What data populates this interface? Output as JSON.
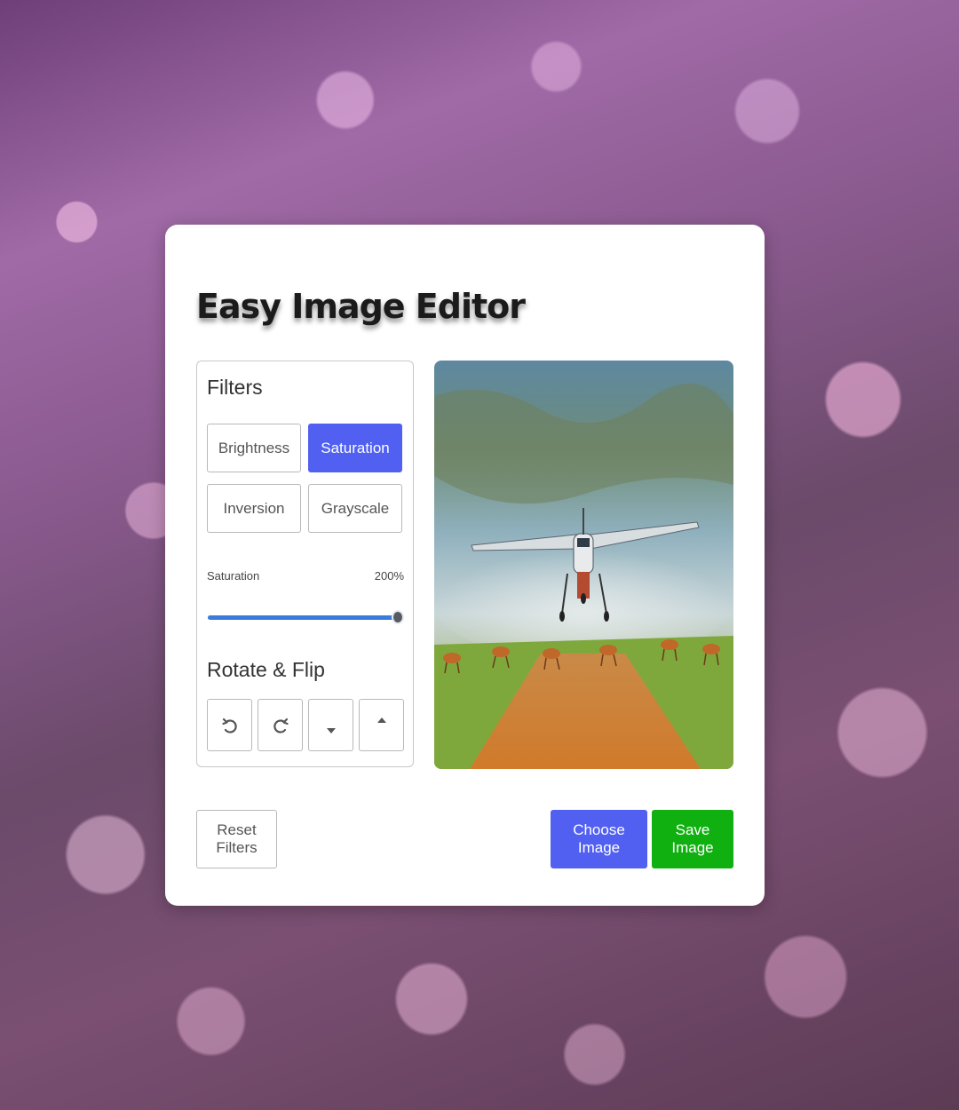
{
  "app": {
    "title": "Easy Image Editor"
  },
  "filters": {
    "title": "Filters",
    "buttons": [
      {
        "label": "Brightness",
        "active": false
      },
      {
        "label": "Saturation",
        "active": true
      },
      {
        "label": "Inversion",
        "active": false
      },
      {
        "label": "Grayscale",
        "active": false
      }
    ],
    "active_color": "#5160f0"
  },
  "slider": {
    "name": "Saturation",
    "value_text": "200%",
    "value": 200,
    "max": 200,
    "fill_color": "#3a7bdc"
  },
  "rotate_flip": {
    "title": "Rotate & Flip",
    "buttons": [
      {
        "icon": "rotate-left-icon"
      },
      {
        "icon": "rotate-right-icon"
      },
      {
        "icon": "flip-vertical-icon"
      },
      {
        "icon": "flip-horizontal-icon"
      }
    ]
  },
  "preview": {
    "description_icon": "image-preview"
  },
  "actions": {
    "reset_label": "Reset Filters",
    "choose_label": "Choose Image",
    "save_label": "Save Image",
    "choose_color": "#5160f0",
    "save_color": "#10b010"
  }
}
